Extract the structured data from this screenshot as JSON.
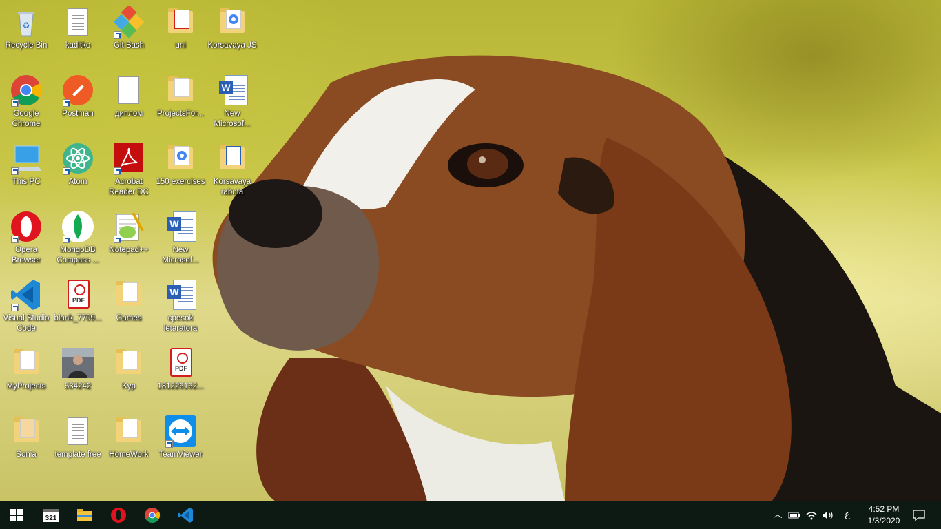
{
  "desktop": {
    "icons": [
      {
        "label": "Recycle Bin",
        "icon": "recycle-bin-icon"
      },
      {
        "label": "kaditko",
        "icon": "text-file-icon"
      },
      {
        "label": "Git Bash",
        "icon": "git-bash-icon"
      },
      {
        "label": "uni",
        "icon": "folder-icon"
      },
      {
        "label": "Korsavaya JS",
        "icon": "folder-icon"
      },
      {
        "label": "Google Chrome",
        "icon": "chrome-icon"
      },
      {
        "label": "Postman",
        "icon": "postman-icon"
      },
      {
        "label": "диплом",
        "icon": "blank-file-icon"
      },
      {
        "label": "ProjectsFor...",
        "icon": "folder-icon"
      },
      {
        "label": "New Microsof...",
        "icon": "word-doc-icon"
      },
      {
        "label": "This PC",
        "icon": "computer-icon"
      },
      {
        "label": "Atom",
        "icon": "atom-icon"
      },
      {
        "label": "Acrobat Reader DC",
        "icon": "acrobat-icon"
      },
      {
        "label": "150 exercises",
        "icon": "folder-icon"
      },
      {
        "label": "Korsavaya rabota",
        "icon": "folder-icon"
      },
      {
        "label": "Opera Browser",
        "icon": "opera-icon"
      },
      {
        "label": "MongoDB Compass ...",
        "icon": "mongodb-icon"
      },
      {
        "label": "Notepad++",
        "icon": "notepadpp-icon"
      },
      {
        "label": "New Microsof...",
        "icon": "word-doc-icon"
      },
      {
        "label": "Visual Studio Code",
        "icon": "vscode-icon"
      },
      {
        "label": "blank_7709...",
        "icon": "pdf-file-icon"
      },
      {
        "label": "Games",
        "icon": "folder-icon"
      },
      {
        "label": "cpesok letaratora",
        "icon": "word-doc-icon"
      },
      {
        "label": "MyProjects",
        "icon": "folder-icon"
      },
      {
        "label": "534242",
        "icon": "photo-icon"
      },
      {
        "label": "Kyp",
        "icon": "folder-icon"
      },
      {
        "label": "181226162...",
        "icon": "pdf-file-icon"
      },
      {
        "label": "Sonia",
        "icon": "folder-icon"
      },
      {
        "label": "template free",
        "icon": "text-file-icon"
      },
      {
        "label": "HomeWork",
        "icon": "folder-icon"
      },
      {
        "label": "TeamViewer",
        "icon": "teamviewer-icon"
      }
    ]
  },
  "taskbar": {
    "apps": [
      "start-icon",
      "calendar-app-icon",
      "file-explorer-icon",
      "opera-icon",
      "chrome-icon",
      "vscode-icon"
    ],
    "calendar_badge": "321",
    "tray": {
      "input_lang": "ع",
      "time": "4:52 PM",
      "date": "1/3/2020"
    }
  }
}
